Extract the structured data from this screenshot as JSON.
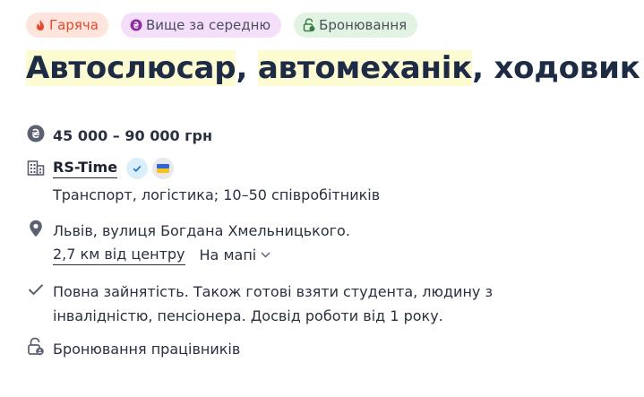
{
  "badges": {
    "hot": {
      "label": "Гаряча",
      "icon": "flame-icon",
      "color": "#e24a2b"
    },
    "salary": {
      "label": "Вище за середню",
      "icon": "hryvnia-coin-icon",
      "color": "#8b2fa0"
    },
    "reservation": {
      "label": "Бронювання",
      "icon": "lock-icon",
      "color": "#3a7d44"
    }
  },
  "title": {
    "part1": "Автослюсар",
    "sep1": ", ",
    "part2": "автомеханік",
    "sep2": ", ходовик"
  },
  "salary": {
    "icon": "hryvnia-icon",
    "text": "45 000 – 90 000 грн"
  },
  "company": {
    "icon": "building-icon",
    "name": "RS-Time",
    "verified_icon": "check-icon",
    "flag_icon": "ukraine-flag-icon",
    "details": "Транспорт, логістика; 10–50 співробітників"
  },
  "location": {
    "icon": "map-pin-icon",
    "address": "Львів, вулиця Богдана Хмельницького.",
    "distance": "2,7 км від центру",
    "map_link": "На мапі"
  },
  "conditions": {
    "icon": "check-icon",
    "text": "Повна зайнятість. Також готові взяти студента, людину з інвалідністю, пенсіонера. Досвід роботи від 1 року."
  },
  "reservation": {
    "icon": "lock-icon",
    "text": "Бронювання працівників"
  }
}
